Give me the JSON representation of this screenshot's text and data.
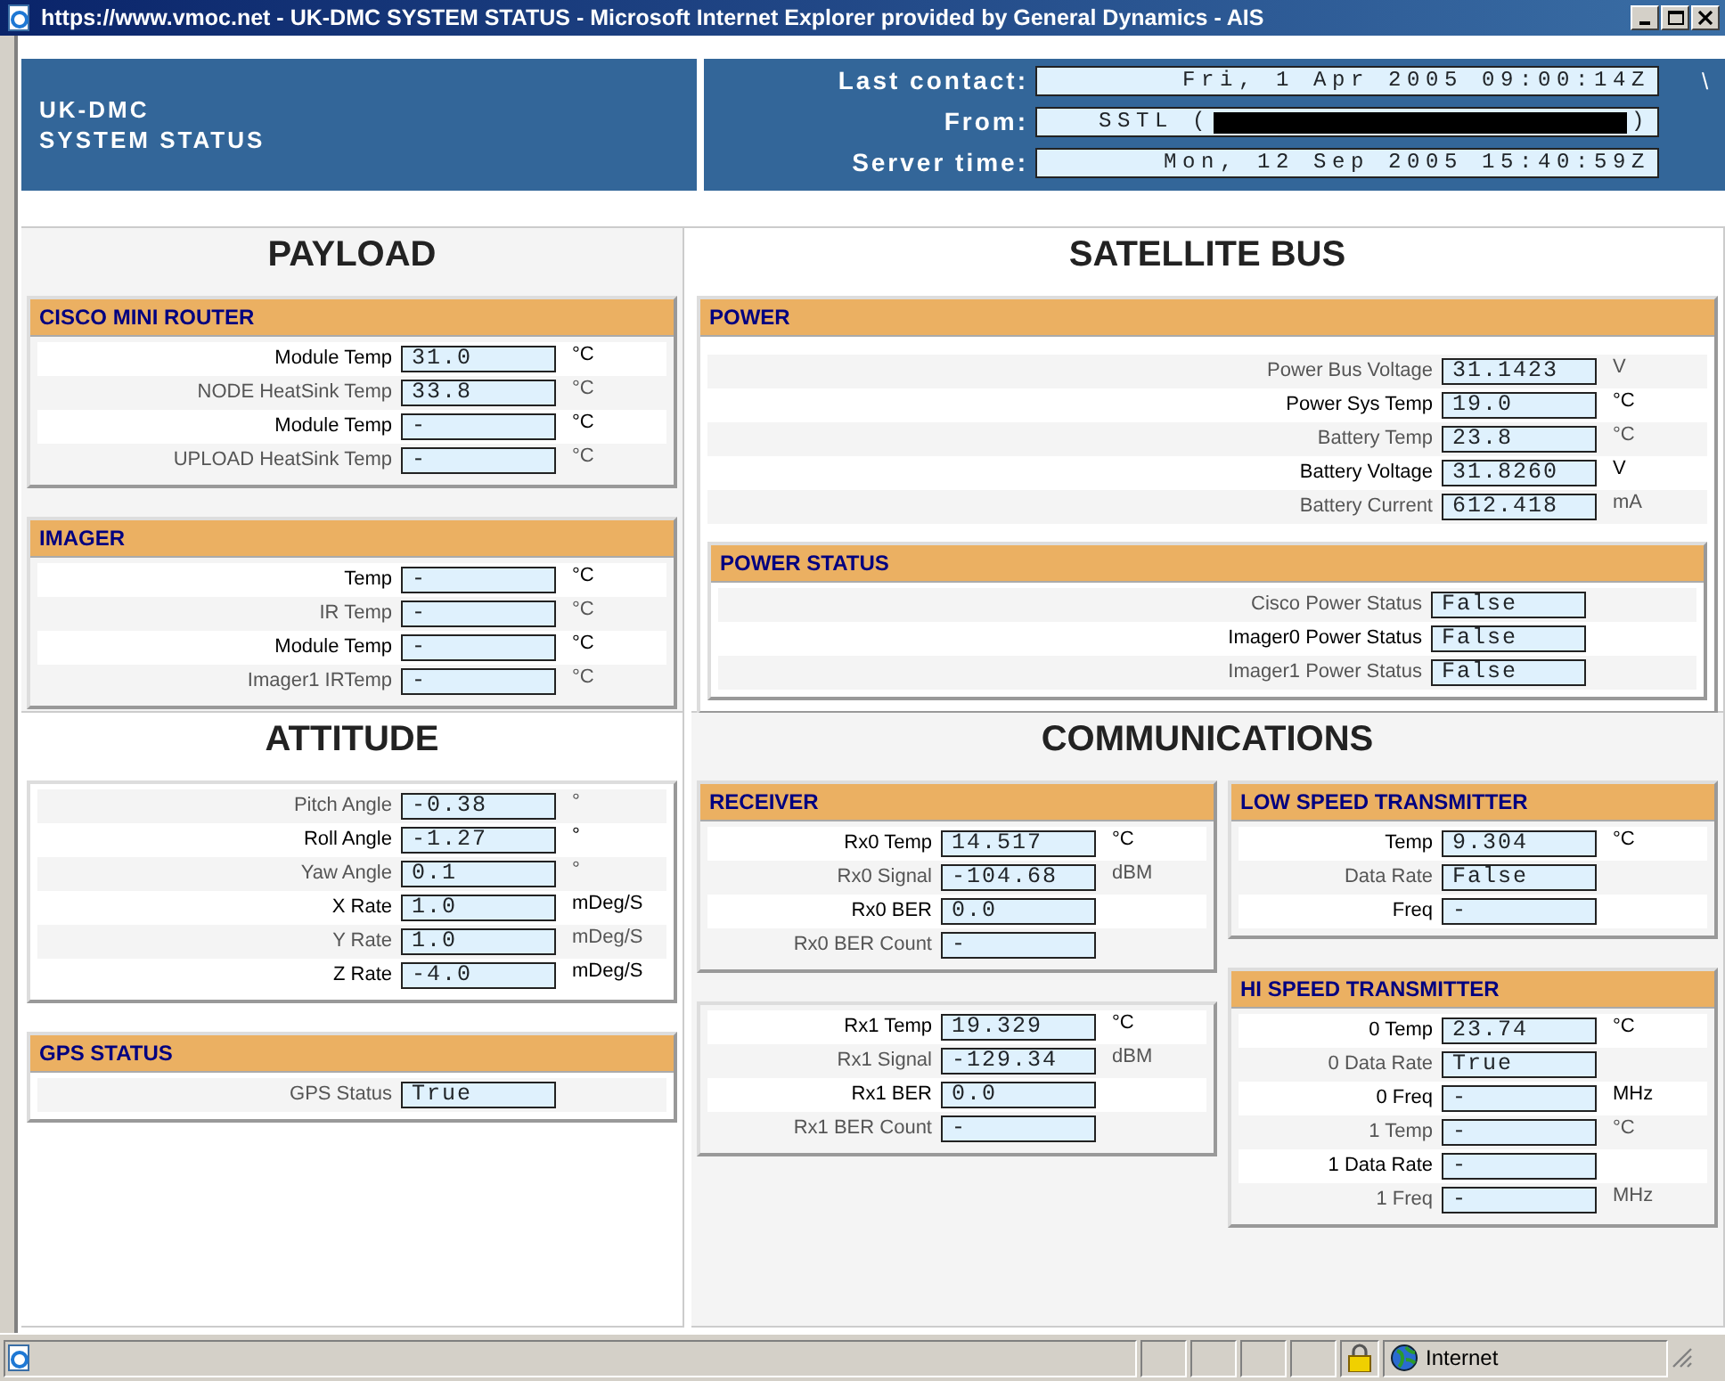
{
  "window": {
    "title": "https://www.vmoc.net - UK-DMC SYSTEM STATUS - Microsoft Internet Explorer provided by General Dynamics - AIS"
  },
  "header": {
    "title_lines": [
      "UK-DMC",
      "SYSTEM STATUS"
    ],
    "fields": [
      {
        "label": "Last contact:",
        "value": "Fri, 1 Apr 2005 09:00:14Z"
      },
      {
        "label": "From:",
        "value": "SSTL (",
        "redacted": true,
        "value_end": ")"
      },
      {
        "label": "Server time:",
        "value": "Mon, 12 Sep 2005 15:40:59Z"
      }
    ],
    "edge_text": "\\"
  },
  "sections": [
    {
      "title": "PAYLOAD",
      "color": "#f4f4f4",
      "columns": [
        [
          {
            "title": "CISCO MINI ROUTER",
            "rows": [
              {
                "label": "Module Temp",
                "value": "31.0",
                "unit": "°C"
              },
              {
                "label": "NODE HeatSink Temp",
                "value": "33.8",
                "unit": "°C"
              },
              {
                "label": "Module Temp",
                "value": "-",
                "unit": "°C"
              },
              {
                "label": "UPLOAD HeatSink Temp",
                "value": "-",
                "unit": "°C"
              }
            ]
          },
          {
            "title": "IMAGER",
            "rows": [
              {
                "label": "Temp",
                "value": "-",
                "unit": "°C"
              },
              {
                "label": "IR Temp",
                "value": "-",
                "unit": "°C"
              },
              {
                "label": "Module Temp",
                "value": "-",
                "unit": "°C"
              },
              {
                "label": "Imager1 IRTemp",
                "value": "-",
                "unit": "°C"
              }
            ]
          }
        ]
      ]
    },
    {
      "title": "SATELLITE BUS",
      "color": "#ffffff",
      "columns": [
        [
          {
            "title": "POWER",
            "rows": [
              {
                "label": "Power Bus Voltage",
                "value": "31.1423",
                "unit": "V"
              },
              {
                "label": "Power Sys Temp",
                "value": "19.0",
                "unit": "°C"
              },
              {
                "label": "Battery Temp",
                "value": "23.8",
                "unit": "°C"
              },
              {
                "label": "Battery Voltage",
                "value": "31.8260",
                "unit": "V"
              },
              {
                "label": "Battery Current",
                "value": "612.418",
                "unit": "mA"
              }
            ],
            "children": [
              {
                "title": "POWER STATUS",
                "rows": [
                  {
                    "label": "Cisco Power Status",
                    "value": "False"
                  },
                  {
                    "label": "Imager0 Power Status",
                    "value": "False"
                  },
                  {
                    "label": "Imager1 Power Status",
                    "value": "False"
                  }
                ]
              }
            ]
          }
        ]
      ]
    },
    {
      "title": "ATTITUDE",
      "color": "#ffffff",
      "columns": [
        [
          {
            "rows": [
              {
                "label": "Pitch Angle",
                "value": "-0.38",
                "unit": "°"
              },
              {
                "label": "Roll Angle",
                "value": "-1.27",
                "unit": "°"
              },
              {
                "label": "Yaw Angle",
                "value": "0.1",
                "unit": "°"
              },
              {
                "label": "X Rate",
                "value": "1.0",
                "unit": "mDeg/S"
              },
              {
                "label": "Y Rate",
                "value": "1.0",
                "unit": "mDeg/S"
              },
              {
                "label": "Z Rate",
                "value": "-4.0",
                "unit": "mDeg/S"
              }
            ]
          },
          {
            "title": "GPS STATUS",
            "rows": [
              {
                "label": "GPS Status",
                "value": "True"
              }
            ]
          }
        ]
      ]
    },
    {
      "title": "COMMUNICATIONS",
      "color": "#f4f4f4",
      "columns": [
        [
          {
            "title": "RECEIVER",
            "rows": [
              {
                "label": "Rx0 Temp",
                "value": "14.517",
                "unit": "°C"
              },
              {
                "label": "Rx0 Signal",
                "value": "-104.68",
                "unit": "dBM"
              },
              {
                "label": "Rx0 BER",
                "value": "0.0"
              },
              {
                "label": "Rx0 BER Count",
                "value": "-"
              }
            ]
          },
          {
            "rows": [
              {
                "label": "Rx1 Temp",
                "value": "19.329",
                "unit": "°C"
              },
              {
                "label": "Rx1 Signal",
                "value": "-129.34",
                "unit": "dBM"
              },
              {
                "label": "Rx1 BER",
                "value": "0.0"
              },
              {
                "label": "Rx1 BER Count",
                "value": "-"
              }
            ]
          }
        ],
        [
          {
            "title": "LOW SPEED TRANSMITTER",
            "rows": [
              {
                "label": "Temp",
                "value": "9.304",
                "unit": "°C"
              },
              {
                "label": "Data Rate",
                "value": "False"
              },
              {
                "label": "Freq",
                "value": "-"
              }
            ]
          },
          {
            "title": "HI SPEED TRANSMITTER",
            "rows": [
              {
                "label": "0 Temp",
                "value": "23.74",
                "unit": "°C"
              },
              {
                "label": "0 Data Rate",
                "value": "True"
              },
              {
                "label": "0 Freq",
                "value": "-",
                "unit": "MHz"
              },
              {
                "label": "1 Temp",
                "value": "-",
                "unit": "°C"
              },
              {
                "label": "1 Data Rate",
                "value": "-"
              },
              {
                "label": "1 Freq",
                "value": "-",
                "unit": "MHz"
              }
            ]
          }
        ]
      ]
    }
  ],
  "status_bar": {
    "zone": "Internet"
  }
}
